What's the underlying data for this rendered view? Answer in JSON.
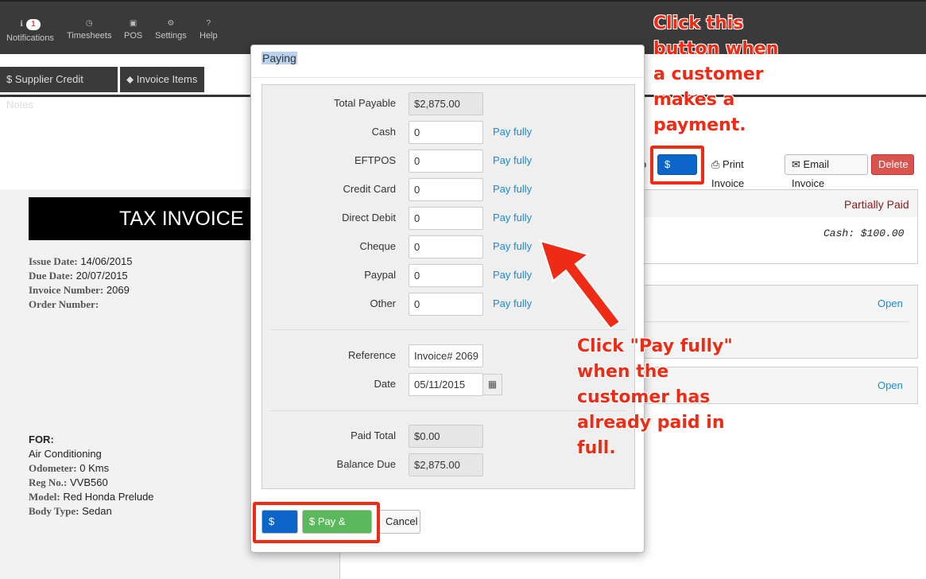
{
  "nav": {
    "notifications": "Notifications",
    "notifications_count": "1",
    "timesheets": "Timesheets",
    "pos": "POS",
    "settings": "Settings",
    "help": "Help"
  },
  "tabs": {
    "supplier_credit_notes": "Supplier Credit Notes",
    "invoice_items": "Invoice Items"
  },
  "invoice": {
    "title": "TAX INVOICE",
    "issue_date_label": "Issue Date:",
    "issue_date": "14/06/2015",
    "due_date_label": "Due Date:",
    "due_date": "20/07/2015",
    "invoice_number_label": "Invoice Number:",
    "invoice_number": "2069",
    "order_number_label": "Order Number:",
    "for_label": "FOR:",
    "for_value": "Air Conditioning",
    "odometer_label": "Odometer:",
    "odometer": "0 Kms",
    "reg_label": "Reg No.:",
    "reg": "VVB560",
    "model_label": "Model:",
    "model": "Red Honda Prelude",
    "body_type_label": "Body Type:",
    "body_type": "Sedan"
  },
  "actions": {
    "partial_letter": "o",
    "pay": "Pay",
    "print_invoice": "Print Invoice",
    "email_invoice": "Email Invoice",
    "delete": "Delete"
  },
  "status": {
    "state": "Partially Paid",
    "cash_line": "Cash:  $100.00",
    "open1": "Open",
    "open2": "Open"
  },
  "modal": {
    "title": "Paying",
    "total_payable_label": "Total Payable",
    "total_payable": "$2,875.00",
    "methods": [
      {
        "label": "Cash",
        "value": "0"
      },
      {
        "label": "EFTPOS",
        "value": "0"
      },
      {
        "label": "Credit Card",
        "value": "0"
      },
      {
        "label": "Direct Debit",
        "value": "0"
      },
      {
        "label": "Cheque",
        "value": "0"
      },
      {
        "label": "Paypal",
        "value": "0"
      },
      {
        "label": "Other",
        "value": "0"
      }
    ],
    "pay_fully": "Pay fully",
    "reference_label": "Reference",
    "reference": "Invoice# 2069",
    "date_label": "Date",
    "date": "05/11/2015",
    "paid_total_label": "Paid Total",
    "paid_total": "$0.00",
    "balance_due_label": "Balance Due",
    "balance_due": "$2,875.00",
    "pay_button": "Pay",
    "pay_print_button": "Pay & Print",
    "cancel_button": "Cancel"
  },
  "annotations": {
    "top": [
      "Click this",
      "button when",
      "a customer",
      "makes a",
      "payment."
    ],
    "middle": [
      "Click \"Pay fully\"",
      "when the",
      "customer has",
      "already paid in",
      "full."
    ]
  },
  "colors": {
    "annotation_red": "#f02b15",
    "primary_blue": "#0c66c9",
    "success_green": "#5cb85c",
    "danger_red": "#d9534f",
    "link_blue": "#1a8ad4"
  }
}
